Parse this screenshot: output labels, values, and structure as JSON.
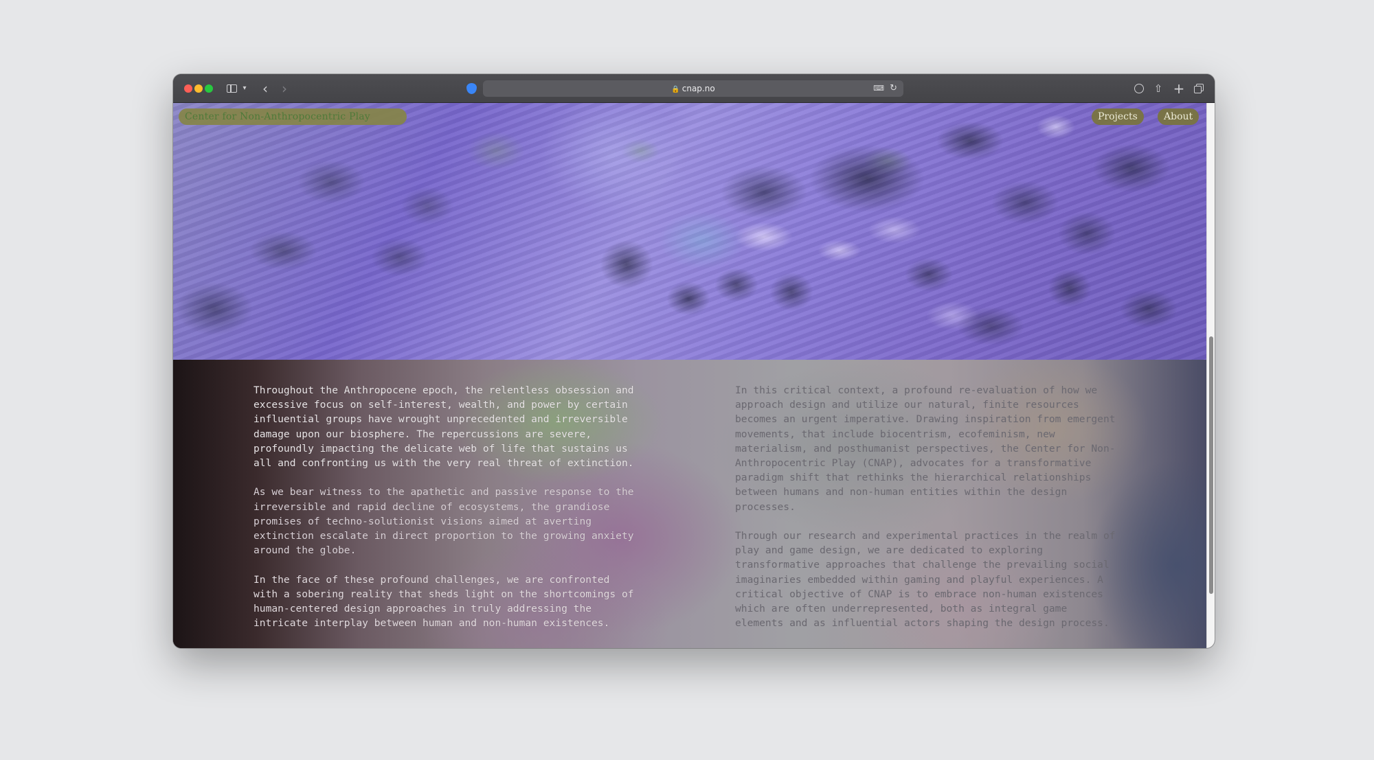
{
  "browser": {
    "url": "cnap.no"
  },
  "site": {
    "title": "Center for Non-Anthropocentric Play",
    "nav": [
      {
        "label": "Projects"
      },
      {
        "label": "About"
      }
    ]
  },
  "content": {
    "left_column": [
      "Throughout the Anthropocene epoch, the relentless obsession and excessive focus on self-interest, wealth, and power by certain influential groups have wrought unprecedented and irreversible damage upon our biosphere. The repercussions are severe, profoundly impacting the delicate web of life that sustains us all and confronting us with the very real threat of extinction.",
      "As we bear witness to the apathetic and passive response to the irreversible and rapid decline of ecosystems, the grandiose promises of techno-solutionist visions aimed at averting extinction escalate in direct proportion to the growing anxiety around the globe.",
      "In the face of these profound challenges, we are confronted with a sobering reality that sheds light on the shortcomings of human-centered design approaches in truly addressing the intricate interplay between human and non-human existences."
    ],
    "right_column": [
      "In this critical context, a profound re-evaluation of how we approach design and utilize our natural, finite resources becomes an urgent imperative. Drawing inspiration from emergent movements, that include biocentrism, ecofeminism, new materialism, and posthumanist perspectives, the Center for Non-Anthropocentric Play (CNAP), advocates for a transformative paradigm shift that rethinks the hierarchical relationships between humans and non-human entities within the design processes.",
      "Through our research and experimental practices in the realm of play and game design, we are dedicated to exploring transformative approaches that challenge the prevailing social imaginaries embedded within gaming and playful experiences. A critical objective of CNAP is to embrace non-human existences which are often underrepresented, both as integral game elements and as influential actors shaping the design process."
    ]
  },
  "colors": {
    "nav_pill": "#797440",
    "hero_purple": "#7766cc",
    "toolbar": "#48484c"
  }
}
